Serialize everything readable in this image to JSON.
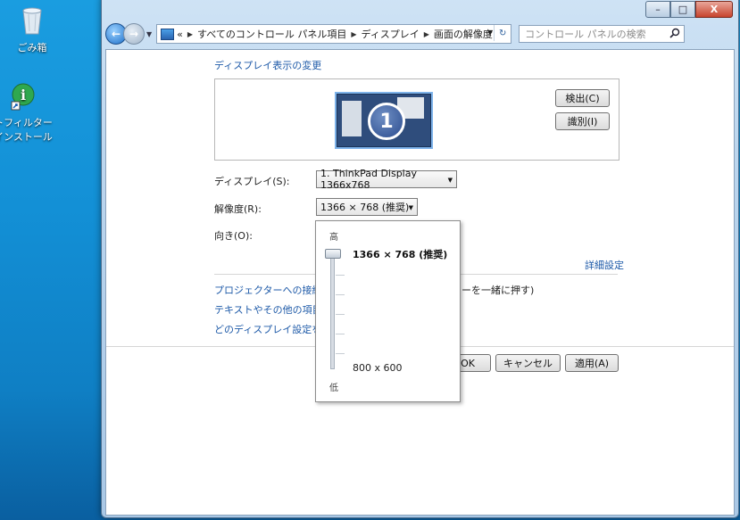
{
  "desktop": {
    "recycle_bin_label": "ごみ箱",
    "info_icon_label_line1": "トフィルター",
    "info_icon_label_line2": "インストール"
  },
  "window": {
    "caption": {
      "minimize": "–",
      "maximize": "□",
      "close": "X"
    },
    "breadcrumb": {
      "prefix": "«",
      "items": [
        "すべてのコントロール パネル項目",
        "ディスプレイ",
        "画面の解像度"
      ]
    },
    "search_placeholder": "コントロール パネルの検索"
  },
  "page": {
    "title": "ディスプレイ表示の変更",
    "detect_button": "検出(C)",
    "identify_button": "識別(I)",
    "monitor_number": "1",
    "display_label": "ディスプレイ(S):",
    "display_value": "1. ThinkPad Display 1366x768",
    "resolution_label": "解像度(R):",
    "resolution_value": "1366 × 768 (推奨)",
    "orientation_label": "向き(O):",
    "advanced_link": "詳細設定",
    "links": {
      "projector_visible": "プロジェクターへの接続 (",
      "projector_tail": "ーを一緒に押す)",
      "text_size_visible": "テキストやその他の項目の",
      "which_settings_visible": "どのディスプレイ設定を選"
    },
    "ok_button": "OK",
    "cancel_button": "キャンセル",
    "apply_button": "適用(A)"
  },
  "resolution_popup": {
    "high_label": "高",
    "low_label": "低",
    "recommended": "1366 × 768 (推奨)",
    "minimum": "800 x 600",
    "current_level": 1.0
  }
}
